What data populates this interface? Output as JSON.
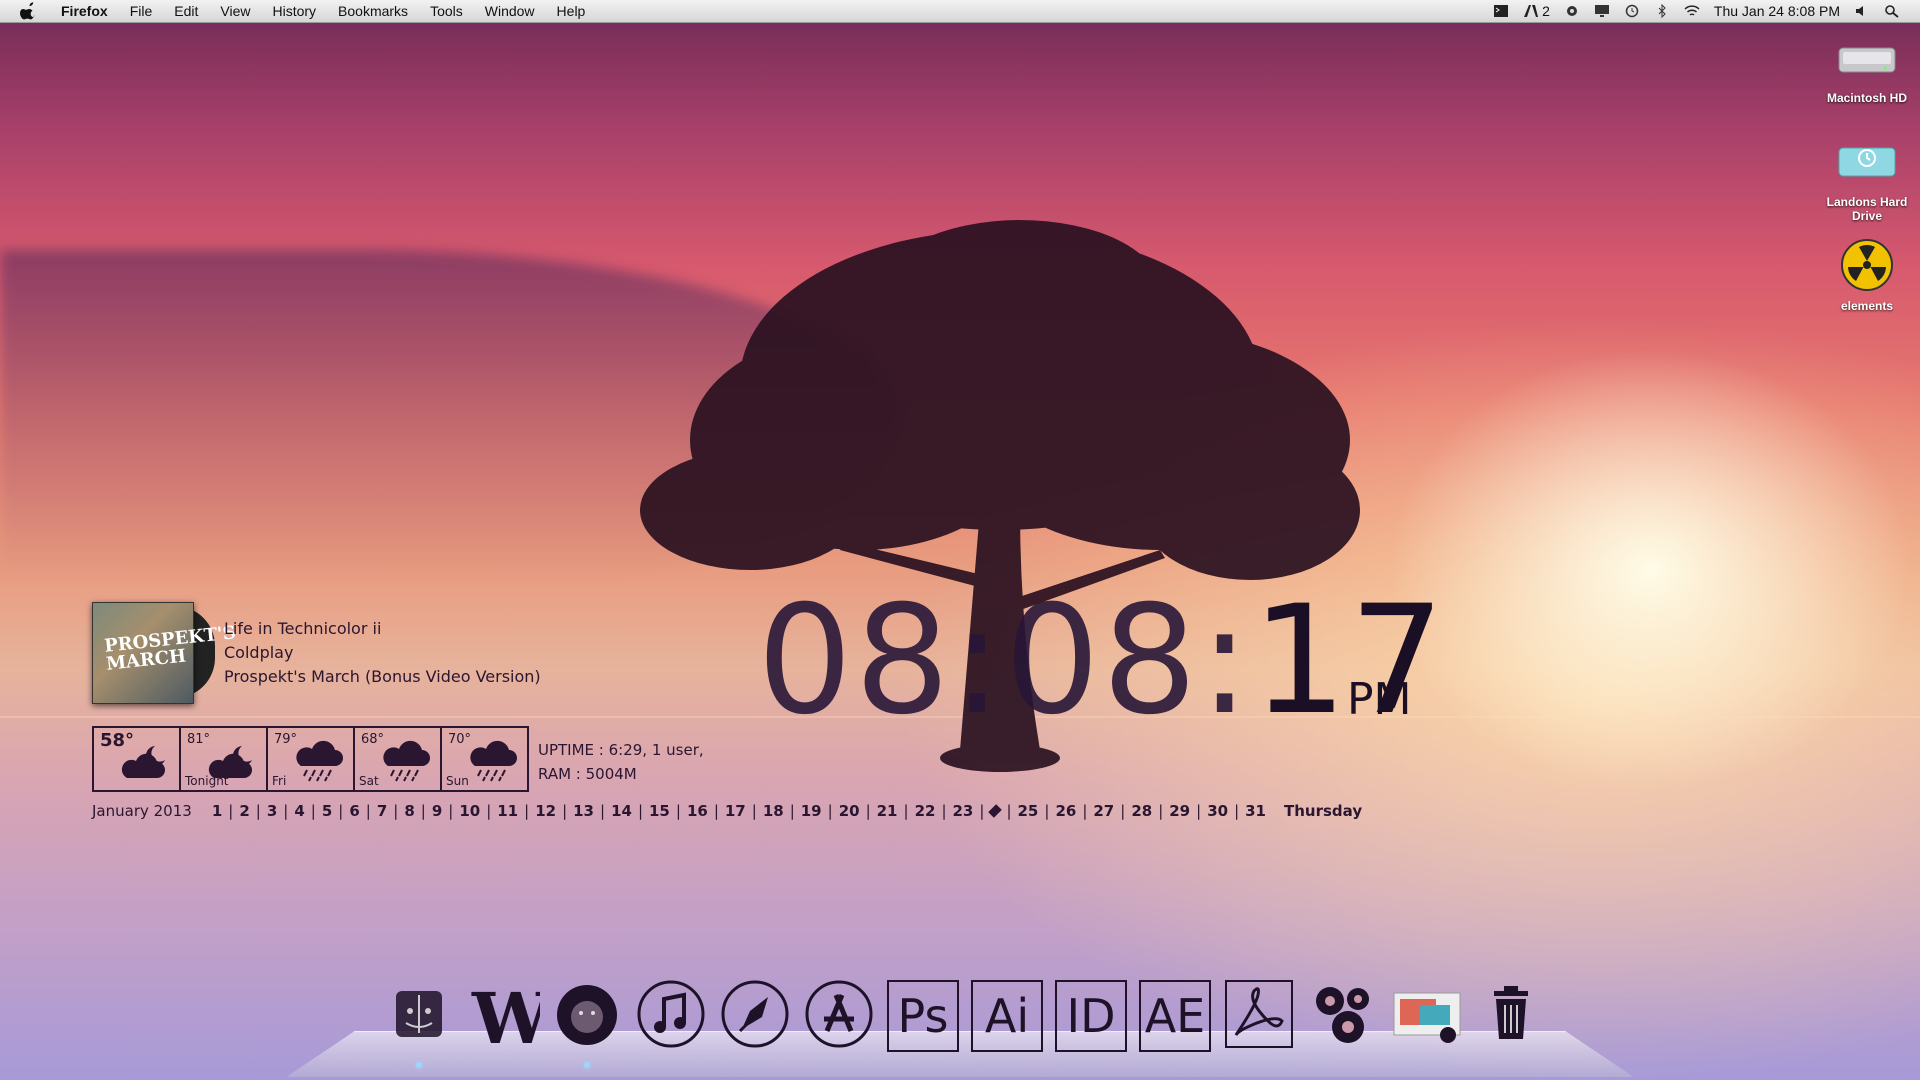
{
  "menubar": {
    "items": [
      "Firefox",
      "File",
      "Edit",
      "View",
      "History",
      "Bookmarks",
      "Tools",
      "Window",
      "Help"
    ],
    "status": {
      "adobe_count": "2",
      "datetime": "Thu Jan 24  8:08 PM"
    }
  },
  "desktop_icons": [
    {
      "label": "Macintosh HD",
      "icon": "hard-drive-icon"
    },
    {
      "label": "Landons Hard Drive",
      "icon": "time-machine-drive-icon"
    },
    {
      "label": "elements",
      "icon": "radiation-icon"
    }
  ],
  "now_playing": {
    "track": "Life in Technicolor ii",
    "artist": "Coldplay",
    "album": "Prospekt's March (Bonus Video Version)",
    "art_text_line1": "PROSPEKT'S",
    "art_text_line2": "MARCH"
  },
  "weather": [
    {
      "temp": "58°",
      "day": "",
      "icon": "cloud-moon-icon"
    },
    {
      "temp": "81°",
      "day": "Tonight",
      "icon": "cloud-moon-icon"
    },
    {
      "temp": "79°",
      "day": "Fri",
      "icon": "rain-icon"
    },
    {
      "temp": "68°",
      "day": "Sat",
      "icon": "rain-icon"
    },
    {
      "temp": "70°",
      "day": "Sun",
      "icon": "rain-icon"
    }
  ],
  "system": {
    "uptime": "UPTIME : 6:29, 1 user,",
    "ram": "RAM : 5004M"
  },
  "calendar": {
    "month": "January 2013",
    "days": [
      "1",
      "2",
      "3",
      "4",
      "5",
      "6",
      "7",
      "8",
      "9",
      "10",
      "11",
      "12",
      "13",
      "14",
      "15",
      "16",
      "17",
      "18",
      "19",
      "20",
      "21",
      "22",
      "23",
      "24",
      "25",
      "26",
      "27",
      "28",
      "29",
      "30",
      "31"
    ],
    "today": "24",
    "dayname": "Thursday"
  },
  "clock": {
    "hours_minutes": "08:08:",
    "seconds": "17",
    "ampm": "PM"
  },
  "dock": [
    {
      "name": "finder-icon",
      "label": ""
    },
    {
      "name": "word-icon",
      "label": ""
    },
    {
      "name": "safari-lion-icon",
      "label": ""
    },
    {
      "name": "itunes-icon",
      "label": ""
    },
    {
      "name": "launchpad-icon",
      "label": ""
    },
    {
      "name": "app-store-icon",
      "label": ""
    },
    {
      "name": "photoshop-icon",
      "label": "Ps"
    },
    {
      "name": "illustrator-icon",
      "label": "Ai"
    },
    {
      "name": "indesign-icon",
      "label": "ID"
    },
    {
      "name": "after-effects-icon",
      "label": "AE"
    },
    {
      "name": "acrobat-icon",
      "label": ""
    },
    {
      "name": "system-preferences-icon",
      "label": ""
    },
    {
      "name": "preview-icon",
      "label": ""
    },
    {
      "name": "trash-icon",
      "label": ""
    }
  ],
  "colors": {
    "widget_text": "#2a1630",
    "menubar_bg": "#e6e6e6"
  }
}
